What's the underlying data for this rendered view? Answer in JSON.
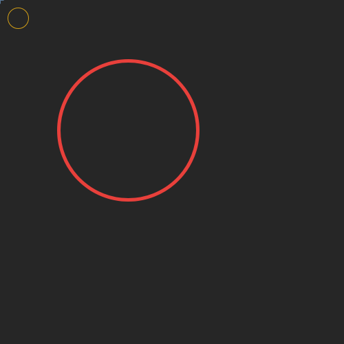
{
  "canvas": {
    "background": "#262626"
  },
  "cursor_ring": {
    "icon": "ring-icon",
    "color": "#d4a017"
  },
  "target_ring": {
    "icon": "ring-icon",
    "color": "#e8403b"
  },
  "corner_mark": {
    "icon": "corner-icon",
    "color": "#5a7a9a"
  }
}
